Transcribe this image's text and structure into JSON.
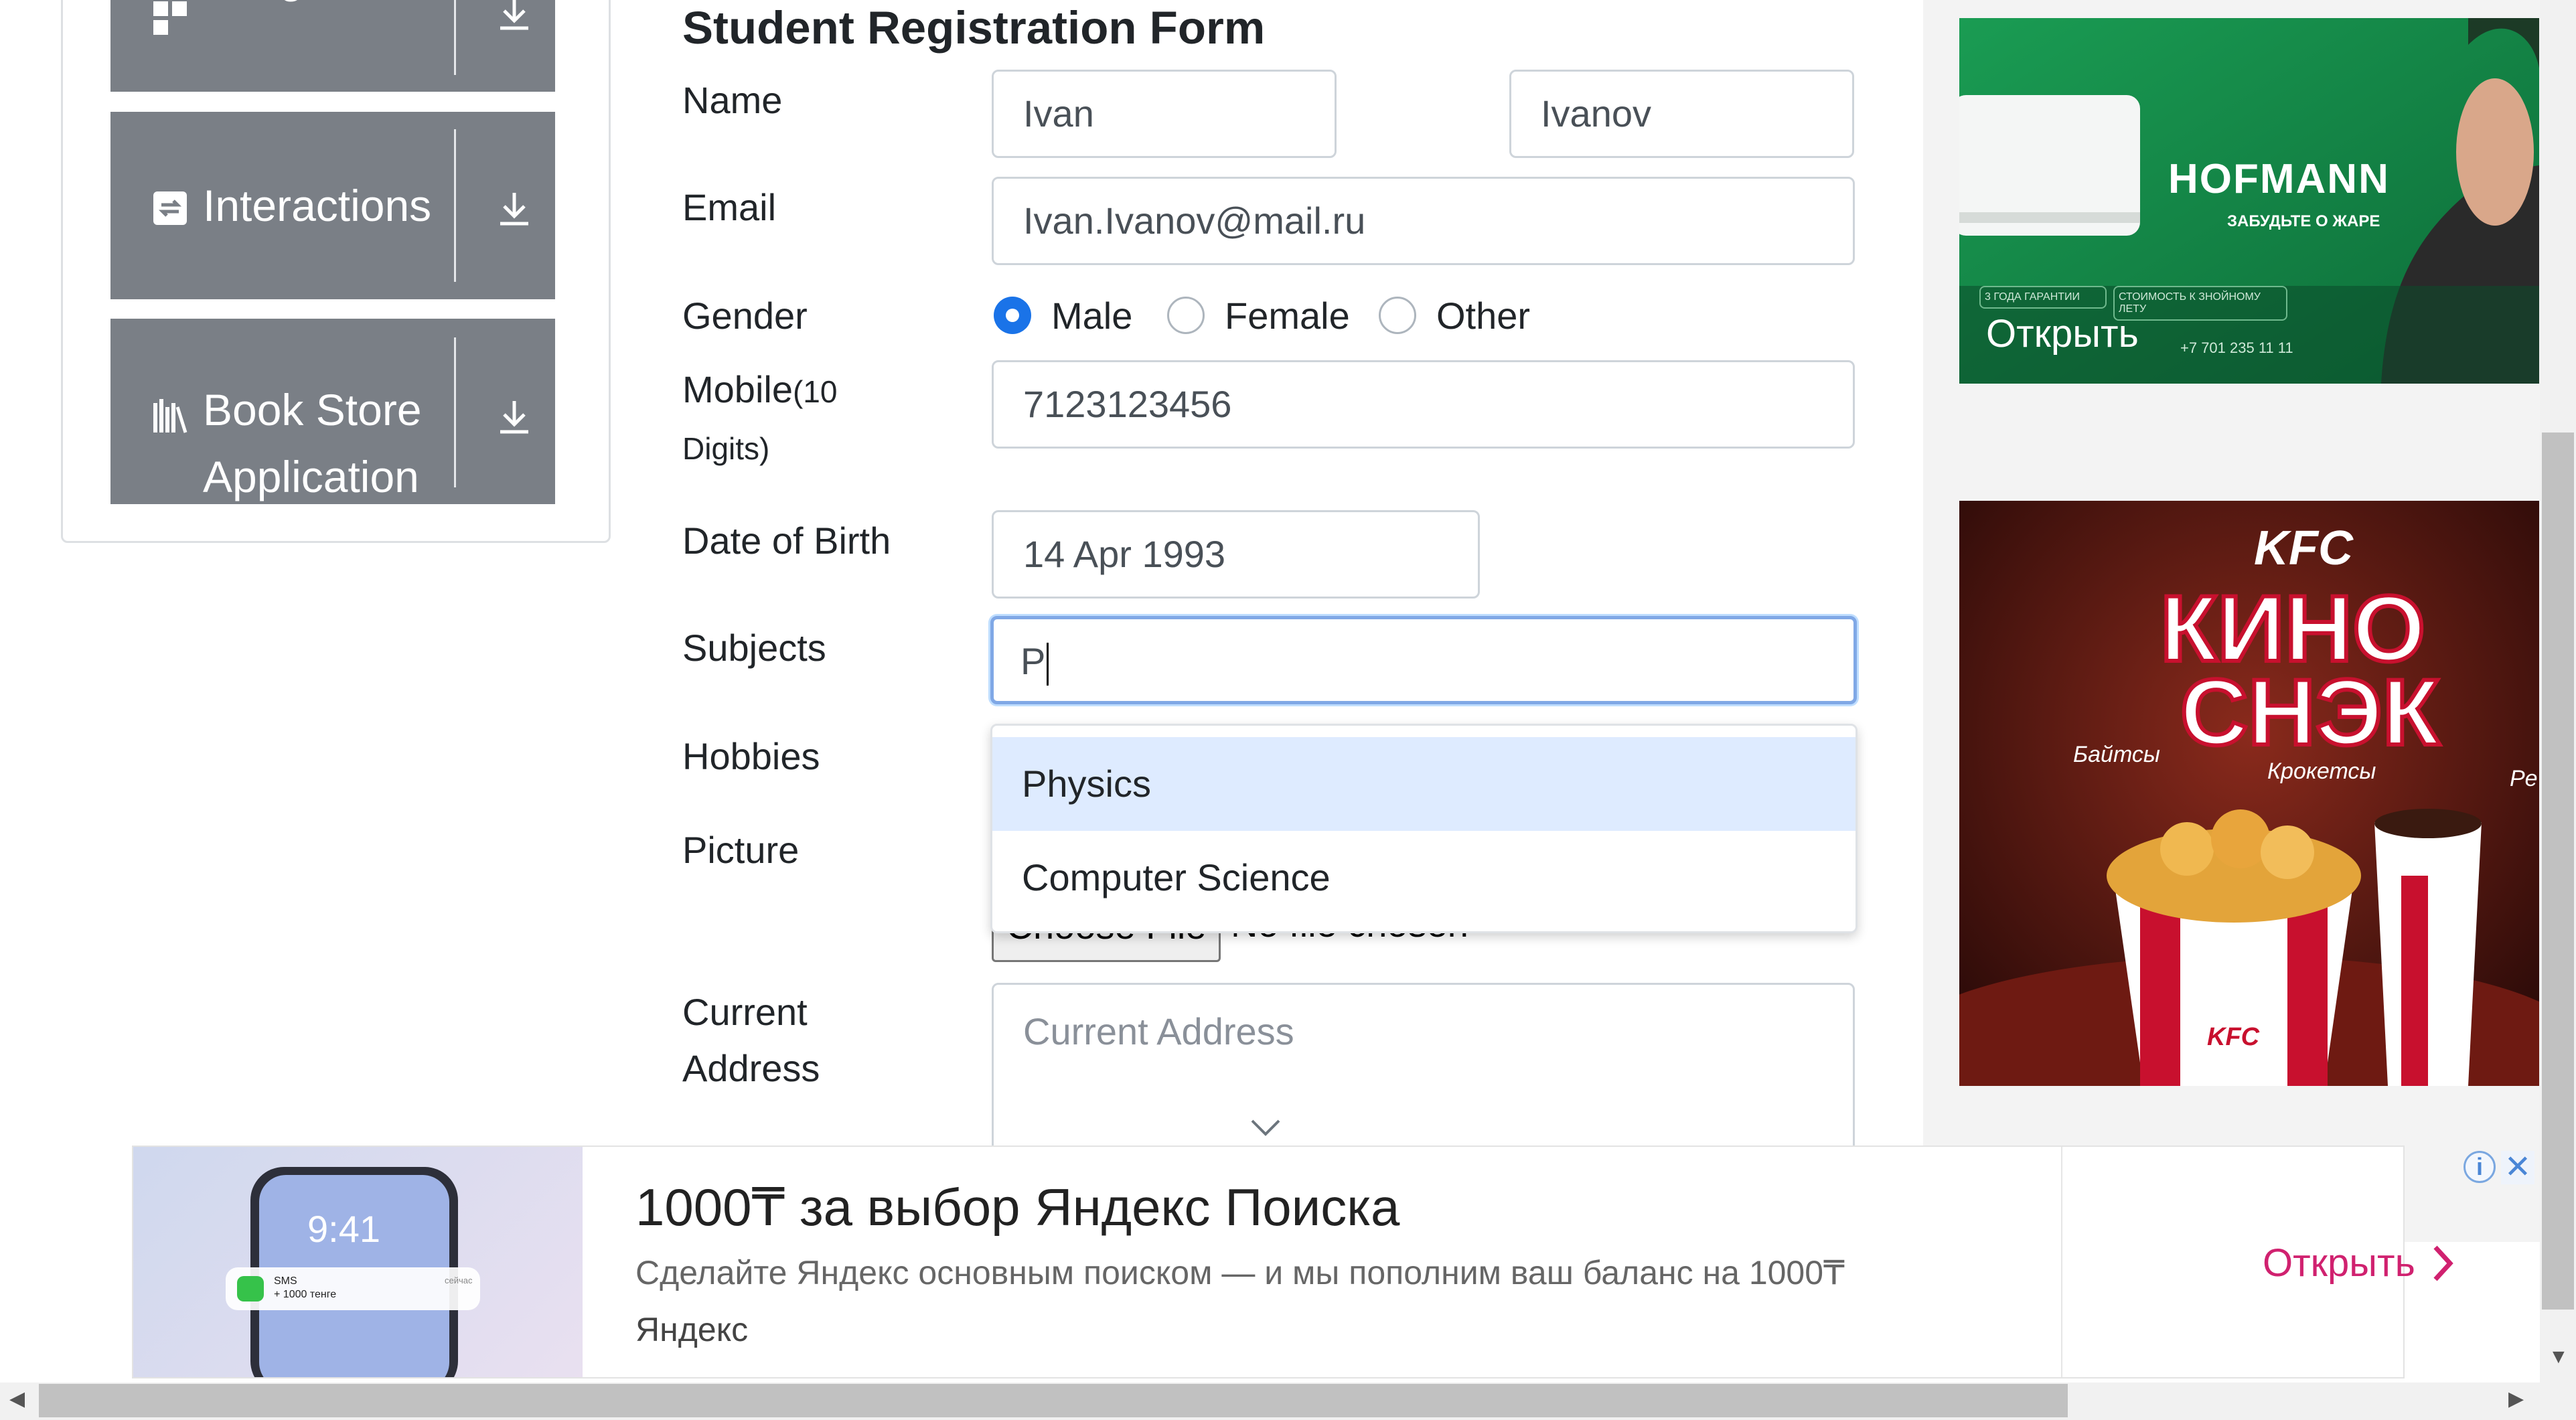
{
  "nav": {
    "items": [
      {
        "label": "Widgets"
      },
      {
        "label": "Interactions"
      },
      {
        "label_line1": "Book Store",
        "label_line2": "Application"
      }
    ]
  },
  "form": {
    "title": "Student Registration Form",
    "name_label": "Name",
    "first_name": "Ivan",
    "last_name": "Ivanov",
    "email_label": "Email",
    "email": "Ivan.Ivanov@mail.ru",
    "gender_label": "Gender",
    "gender_options": [
      "Male",
      "Female",
      "Other"
    ],
    "gender_selected": "Male",
    "mobile_label": "Mobile",
    "mobile_hint1": "(10",
    "mobile_hint2": "Digits)",
    "mobile": "7123123456",
    "dob_label": "Date of Birth",
    "dob": "14 Apr 1993",
    "subjects_label": "Subjects",
    "subjects_value": "P",
    "subjects_options": [
      "Physics",
      "Computer Science"
    ],
    "hobbies_label": "Hobbies",
    "picture_label": "Picture",
    "file_button": "Choose File",
    "file_status": "No file chosen",
    "address_label1": "Current",
    "address_label2": "Address",
    "address_placeholder": "Current Address"
  },
  "ads": {
    "hofmann_brand": "HOFMANN",
    "hofmann_tagline": "ЗАБУДЬТЕ О ЖАРЕ",
    "hofmann_badge1": "3 ГОДА ГАРАНТИИ",
    "hofmann_badge2": "СТОИМОСТЬ К ЗНОЙНОМУ ЛЕТУ",
    "hofmann_phone": "+7 701 235 11 11",
    "hofmann_open": "Открыть",
    "kfc_logo": "KFC",
    "kfc_title1": "КИНО",
    "kfc_title2": "СНЭК",
    "kfc_note1": "Байтсы",
    "kfc_note2": "Крокетсы",
    "kfc_note3": "Pe",
    "kfc_bucket": "KFC",
    "banner_title": "1000₸ за выбор Яндекс Поиска",
    "banner_desc": "Сделайте Яндекс основным поиском — и мы пополним ваш баланс на 1000₸",
    "banner_brand": "Яндекс",
    "banner_open": "Открыть",
    "banner_phone_time": "9:41",
    "banner_sms_title": "SMS",
    "banner_sms_text": "+ 1000 тенге",
    "banner_sms_time": "сейчас",
    "info_glyph": "i",
    "close_glyph": "✕"
  },
  "colors": {
    "nav_item_bg": "#7a7f86",
    "radio_selected": "#1a73e8",
    "focus_border": "#80a8e6",
    "dropdown_highlight": "#deebff",
    "hofmann_green": "#1e8a4c",
    "kfc_red": "#c8102e",
    "banner_open": "#d0216f"
  }
}
